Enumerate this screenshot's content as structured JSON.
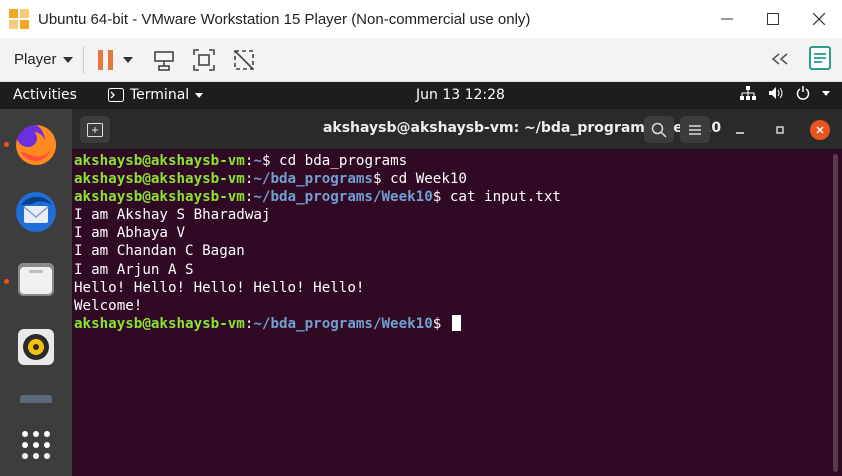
{
  "window": {
    "title": "Ubuntu 64-bit - VMware Workstation 15 Player (Non-commercial use only)",
    "minimize_icon": "minimize-icon",
    "maximize_icon": "maximize-icon",
    "close_icon": "close-icon"
  },
  "vm_toolbar": {
    "player_label": "Player",
    "icons": [
      "pause-icon",
      "send-ctrl-alt-del-icon",
      "fit-guest-icon",
      "unity-icon",
      "rewind-icon",
      "notes-icon"
    ]
  },
  "gnome_bar": {
    "activities": "Activities",
    "app_name": "Terminal",
    "clock": "Jun 13  12:28"
  },
  "dock": {
    "apps": [
      "firefox",
      "thunderbird",
      "files",
      "rhythmbox",
      "show-applications"
    ]
  },
  "terminal": {
    "title": "akshaysb@akshaysb-vm: ~/bda_programs/Week10",
    "prompt_user": "akshaysb@akshaysb-vm",
    "lines": [
      {
        "type": "prompt",
        "path": "~",
        "command": "cd bda_programs"
      },
      {
        "type": "prompt",
        "path": "~/bda_programs",
        "command": "cd Week10"
      },
      {
        "type": "prompt",
        "path": "~/bda_programs/Week10",
        "command": "cat input.txt"
      },
      {
        "type": "output",
        "text": "I am Akshay S Bharadwaj"
      },
      {
        "type": "output",
        "text": "I am Abhaya V"
      },
      {
        "type": "output",
        "text": "I am Chandan C Bagan"
      },
      {
        "type": "output",
        "text": "I am Arjun A S"
      },
      {
        "type": "output",
        "text": "Hello! Hello! Hello! Hello! Hello!"
      },
      {
        "type": "output",
        "text": "Welcome!"
      },
      {
        "type": "prompt",
        "path": "~/bda_programs/Week10",
        "command": ""
      }
    ]
  },
  "colors": {
    "terminal_bg": "#300a24",
    "prompt_user": "#8ae234",
    "prompt_path": "#729fcf",
    "accent": "#e95420"
  }
}
